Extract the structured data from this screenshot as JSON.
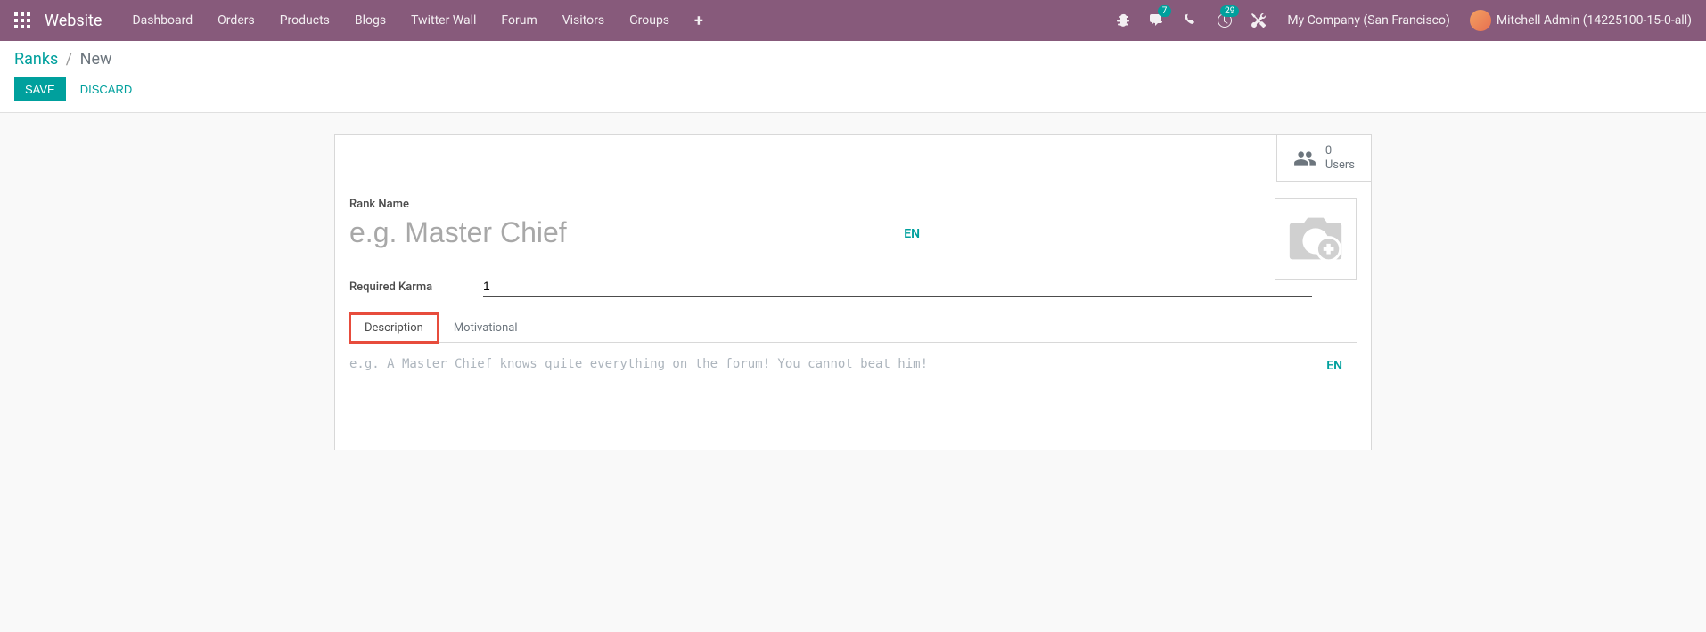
{
  "navbar": {
    "brand": "Website",
    "menu": [
      "Dashboard",
      "Orders",
      "Products",
      "Blogs",
      "Twitter Wall",
      "Forum",
      "Visitors",
      "Groups"
    ],
    "plus": "+",
    "badges": {
      "messages": "7",
      "activities": "29"
    },
    "company": "My Company (San Francisco)",
    "user": "Mitchell Admin (14225100-15-0-all)"
  },
  "breadcrumb": {
    "root": "Ranks",
    "sep": "/",
    "current": "New"
  },
  "buttons": {
    "save": "Save",
    "discard": "Discard"
  },
  "stat": {
    "count": "0",
    "label": "Users"
  },
  "form": {
    "rank_name_label": "Rank Name",
    "rank_name_value": "",
    "rank_name_placeholder": "e.g. Master Chief",
    "lang_btn": "EN",
    "karma_label": "Required Karma",
    "karma_value": "1"
  },
  "tabs": {
    "description": "Description",
    "motivational": "Motivational",
    "desc_placeholder": "e.g. A Master Chief knows quite everything on the forum! You cannot beat him!",
    "desc_value": "",
    "desc_lang": "EN"
  }
}
